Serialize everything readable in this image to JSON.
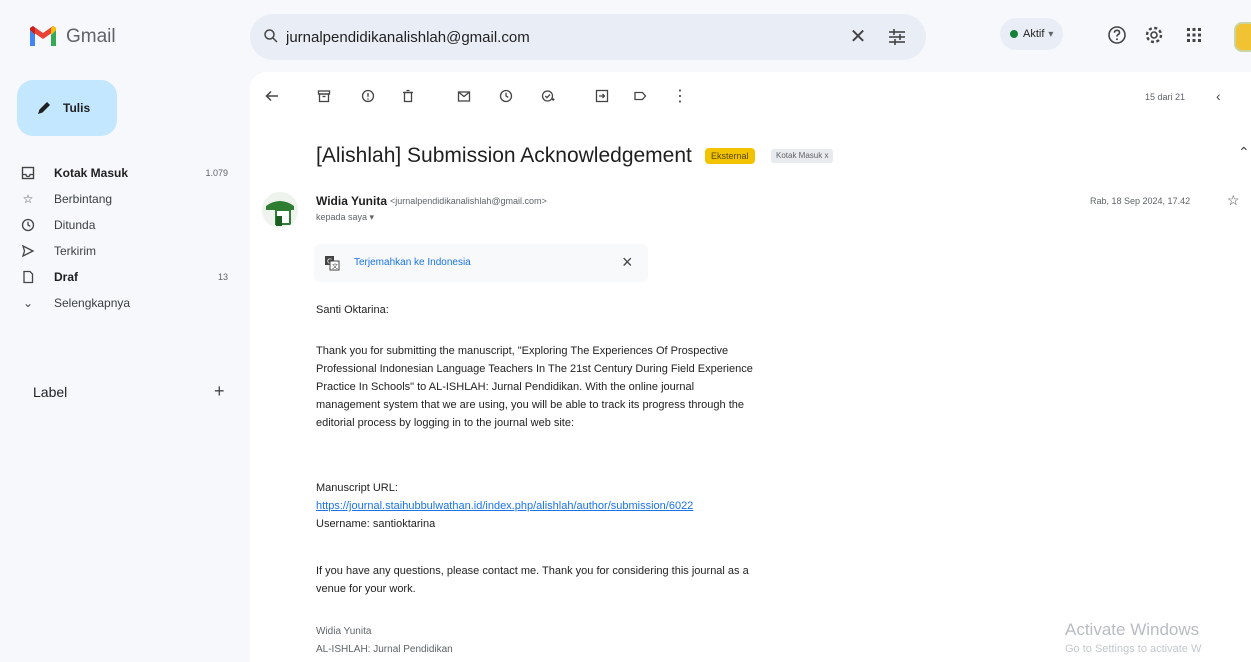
{
  "app": {
    "name": "Gmail"
  },
  "search": {
    "value": "jurnalpendidikanalishlah@gmail.com"
  },
  "status": {
    "label": "Aktif"
  },
  "sidebar": {
    "compose_label": "Tulis",
    "items": [
      {
        "label": "Kotak Masuk",
        "count": "1.079",
        "icon": "inbox-icon"
      },
      {
        "label": "Berbintang",
        "count": "",
        "icon": "star-icon"
      },
      {
        "label": "Ditunda",
        "count": "",
        "icon": "clock-icon"
      },
      {
        "label": "Terkirim",
        "count": "",
        "icon": "send-icon"
      },
      {
        "label": "Draf",
        "count": "13",
        "icon": "draft-icon"
      },
      {
        "label": "Selengkapnya",
        "count": "",
        "icon": "chevron-down-icon"
      }
    ],
    "labels_heading": "Label"
  },
  "toolbar": {
    "pager": "15 dari 21"
  },
  "email": {
    "subject": "[Alishlah] Submission Acknowledgement",
    "badge_external": "Eksternal",
    "badge_inbox": "Kotak Masuk x",
    "sender_name": "Widia Yunita",
    "sender_email": "<jurnalpendidikanalishlah@gmail.com>",
    "recipient": "kepada saya",
    "date": "Rab, 18 Sep 2024, 17.42",
    "translate_link": "Terjemahkan ke Indonesia",
    "greeting": "Santi Oktarina:",
    "paragraph1": "Thank you for submitting the manuscript, \"Exploring The Experiences Of Prospective Professional Indonesian Language Teachers In The 21st Century During Field Experience Practice In Schools\" to AL-ISHLAH: Jurnal Pendidikan. With the online journal management system that we are using, you will be able to track its progress through the editorial process by logging in to the journal web site:",
    "url_label": "Manuscript URL:",
    "url": "https://journal.staihubbulwathan.id/index.php/alishlah/author/submission/6022",
    "username": "Username: santioktarina",
    "paragraph2": "If you have any questions, please contact me. Thank you for considering this journal as a venue for your work.",
    "signature_name": "Widia Yunita",
    "signature_org": "AL-ISHLAH: Jurnal Pendidikan"
  },
  "watermark": {
    "line1": "Activate Windows",
    "line2": "Go to Settings to activate W"
  },
  "colors": {
    "accent": "#1a73e8",
    "compose_bg": "#c2e7ff",
    "external_badge": "#f2c300",
    "active_status": "#188038"
  }
}
